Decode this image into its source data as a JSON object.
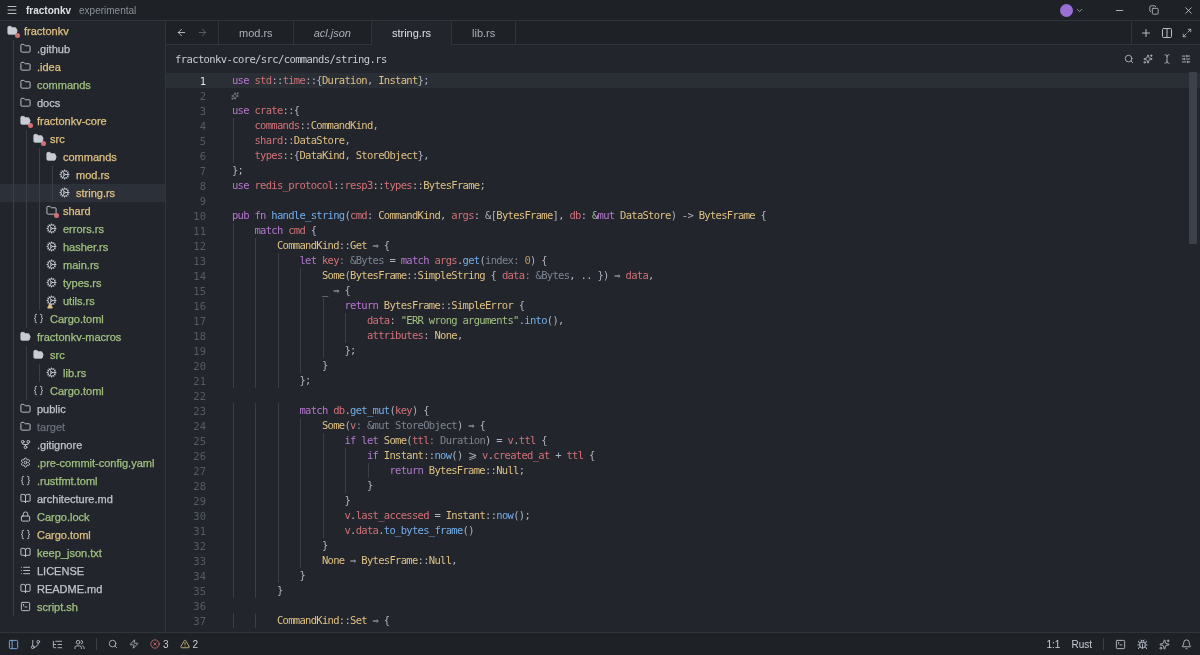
{
  "title_bar": {
    "project": "fractonkv",
    "branch": "experimental"
  },
  "sidebar": {
    "items": [
      {
        "name": "fractonkv",
        "kind": "folder",
        "color": "#dec184",
        "expanded": true,
        "selected": false,
        "has_error": true,
        "children": [
          {
            "name": ".github",
            "kind": "folder",
            "color": "#c0c5cd",
            "expanded": false,
            "selected": false
          },
          {
            "name": ".idea",
            "kind": "folder",
            "color": "#dec184",
            "expanded": false,
            "selected": false
          },
          {
            "name": "commands",
            "kind": "folder",
            "color": "#a1c181",
            "expanded": false,
            "selected": false
          },
          {
            "name": "docs",
            "kind": "folder",
            "color": "#c0c5cd",
            "expanded": false,
            "selected": false
          },
          {
            "name": "fractonkv-core",
            "kind": "folder",
            "color": "#dec184",
            "expanded": true,
            "selected": false,
            "has_error": true,
            "children": [
              {
                "name": "src",
                "kind": "folder",
                "color": "#dec184",
                "expanded": true,
                "selected": false,
                "has_error": true,
                "children": [
                  {
                    "name": "commands",
                    "kind": "folder",
                    "color": "#dec184",
                    "expanded": true,
                    "selected": false,
                    "children": [
                      {
                        "name": "mod.rs",
                        "kind": "rust",
                        "color": "#dec184",
                        "selected": false
                      },
                      {
                        "name": "string.rs",
                        "kind": "rust",
                        "color": "#dec184",
                        "selected": true
                      }
                    ]
                  },
                  {
                    "name": "shard",
                    "kind": "folder",
                    "color": "#dec184",
                    "expanded": false,
                    "selected": false,
                    "has_error": true
                  },
                  {
                    "name": "errors.rs",
                    "kind": "rust",
                    "color": "#a1c181",
                    "selected": false
                  },
                  {
                    "name": "hasher.rs",
                    "kind": "rust",
                    "color": "#a1c181",
                    "selected": false
                  },
                  {
                    "name": "main.rs",
                    "kind": "rust",
                    "color": "#a1c181",
                    "selected": false
                  },
                  {
                    "name": "types.rs",
                    "kind": "rust",
                    "color": "#a1c181",
                    "selected": false
                  },
                  {
                    "name": "utils.rs",
                    "kind": "rust",
                    "color": "#a1c181",
                    "selected": false,
                    "has_warning": true
                  }
                ]
              },
              {
                "name": "Cargo.toml",
                "kind": "toml",
                "color": "#a1c181",
                "selected": false
              }
            ]
          },
          {
            "name": "fractonkv-macros",
            "kind": "folder",
            "color": "#a1c181",
            "expanded": true,
            "selected": false,
            "children": [
              {
                "name": "src",
                "kind": "folder",
                "color": "#a1c181",
                "expanded": true,
                "selected": false,
                "children": [
                  {
                    "name": "lib.rs",
                    "kind": "rust",
                    "color": "#a1c181",
                    "selected": false
                  }
                ]
              },
              {
                "name": "Cargo.toml",
                "kind": "toml",
                "color": "#a1c181",
                "selected": false
              }
            ]
          },
          {
            "name": "public",
            "kind": "folder",
            "color": "#c0c5cd",
            "expanded": false,
            "selected": false
          },
          {
            "name": "target",
            "kind": "folder",
            "color": "#6b717c",
            "expanded": false,
            "selected": false
          },
          {
            "name": ".gitignore",
            "kind": "git",
            "color": "#c0c5cd",
            "selected": false
          },
          {
            "name": ".pre-commit-config.yaml",
            "kind": "config",
            "color": "#a1c181",
            "selected": false
          },
          {
            "name": ".rustfmt.toml",
            "kind": "toml",
            "color": "#a1c181",
            "selected": false
          },
          {
            "name": "architecture.md",
            "kind": "book",
            "color": "#c0c5cd",
            "selected": false
          },
          {
            "name": "Cargo.lock",
            "kind": "lock",
            "color": "#a1c181",
            "selected": false
          },
          {
            "name": "Cargo.toml",
            "kind": "toml",
            "color": "#dec184",
            "selected": false
          },
          {
            "name": "keep_json.txt",
            "kind": "book",
            "color": "#a1c181",
            "selected": false
          },
          {
            "name": "LICENSE",
            "kind": "text",
            "color": "#c0c5cd",
            "selected": false
          },
          {
            "name": "README.md",
            "kind": "book",
            "color": "#c0c5cd",
            "selected": false
          },
          {
            "name": "script.sh",
            "kind": "terminal",
            "color": "#a1c181",
            "selected": false
          }
        ]
      }
    ]
  },
  "tabs": [
    {
      "label": "mod.rs",
      "selected": false,
      "preview": false
    },
    {
      "label": "acl.json",
      "selected": false,
      "preview": true
    },
    {
      "label": "string.rs",
      "selected": true,
      "preview": false
    },
    {
      "label": "lib.rs",
      "selected": false,
      "preview": false
    }
  ],
  "navigation": {
    "back_disabled": false,
    "forward_disabled": true
  },
  "breadcrumb": "fractonkv-core/src/commands/string.rs",
  "editor": {
    "lines": [
      {
        "number": "1",
        "active": true,
        "tokens": [
          {
            "kind": "keyword",
            "text": "use "
          },
          {
            "kind": "variable",
            "text": "std"
          },
          {
            "kind": "plain",
            "text": "::"
          },
          {
            "kind": "variable",
            "text": "time"
          },
          {
            "kind": "plain",
            "text": "::{"
          },
          {
            "kind": "type",
            "text": "Duration"
          },
          {
            "kind": "plain",
            "text": ", "
          },
          {
            "kind": "type",
            "text": "Instant"
          },
          {
            "kind": "plain",
            "text": "};"
          }
        ]
      },
      {
        "number": "2",
        "active": false,
        "gutter_icon": true
      },
      {
        "number": "3",
        "active": false,
        "tokens": [
          {
            "kind": "keyword",
            "text": "use "
          },
          {
            "kind": "variable",
            "text": "crate"
          },
          {
            "kind": "plain",
            "text": "::{"
          }
        ]
      },
      {
        "number": "4",
        "active": false,
        "tokens": [
          {
            "kind": "variable",
            "text": "    commands"
          },
          {
            "kind": "plain",
            "text": "::"
          },
          {
            "kind": "type",
            "text": "CommandKind"
          },
          {
            "kind": "plain",
            "text": ","
          }
        ]
      },
      {
        "number": "5",
        "active": false,
        "tokens": [
          {
            "kind": "variable",
            "text": "    shard"
          },
          {
            "kind": "plain",
            "text": "::"
          },
          {
            "kind": "type",
            "text": "DataStore"
          },
          {
            "kind": "plain",
            "text": ","
          }
        ]
      },
      {
        "number": "6",
        "active": false,
        "tokens": [
          {
            "kind": "variable",
            "text": "    types"
          },
          {
            "kind": "plain",
            "text": "::{"
          },
          {
            "kind": "type",
            "text": "DataKind"
          },
          {
            "kind": "plain",
            "text": ", "
          },
          {
            "kind": "type",
            "text": "StoreObject"
          },
          {
            "kind": "plain",
            "text": "},"
          }
        ]
      },
      {
        "number": "7",
        "active": false,
        "tokens": [
          {
            "kind": "plain",
            "text": "};"
          }
        ]
      },
      {
        "number": "8",
        "active": false,
        "tokens": [
          {
            "kind": "keyword",
            "text": "use "
          },
          {
            "kind": "variable",
            "text": "redis_protocol"
          },
          {
            "kind": "plain",
            "text": "::"
          },
          {
            "kind": "variable",
            "text": "resp3"
          },
          {
            "kind": "plain",
            "text": "::"
          },
          {
            "kind": "variable",
            "text": "types"
          },
          {
            "kind": "plain",
            "text": "::"
          },
          {
            "kind": "type",
            "text": "BytesFrame"
          },
          {
            "kind": "plain",
            "text": ";"
          }
        ]
      },
      {
        "number": "9",
        "active": false
      },
      {
        "number": "10",
        "active": false,
        "tokens": [
          {
            "kind": "keyword",
            "text": "pub fn "
          },
          {
            "kind": "function",
            "text": "handle_string"
          },
          {
            "kind": "plain",
            "text": "("
          },
          {
            "kind": "variable",
            "text": "cmd"
          },
          {
            "kind": "plain",
            "text": ": "
          },
          {
            "kind": "type",
            "text": "CommandKind"
          },
          {
            "kind": "plain",
            "text": ", "
          },
          {
            "kind": "variable",
            "text": "args"
          },
          {
            "kind": "plain",
            "text": ": &["
          },
          {
            "kind": "type",
            "text": "BytesFrame"
          },
          {
            "kind": "plain",
            "text": "], "
          },
          {
            "kind": "variable",
            "text": "db"
          },
          {
            "kind": "plain",
            "text": ": &"
          },
          {
            "kind": "keyword",
            "text": "mut "
          },
          {
            "kind": "type",
            "text": "DataStore"
          },
          {
            "kind": "plain",
            "text": ") -> "
          },
          {
            "kind": "type",
            "text": "BytesFrame"
          },
          {
            "kind": "plain",
            "text": " {"
          }
        ]
      },
      {
        "number": "11",
        "active": false,
        "tokens": [
          {
            "kind": "keyword",
            "text": "    match "
          },
          {
            "kind": "variable",
            "text": "cmd"
          },
          {
            "kind": "plain",
            "text": " {"
          }
        ]
      },
      {
        "number": "12",
        "active": false,
        "tokens": [
          {
            "kind": "type",
            "text": "        CommandKind"
          },
          {
            "kind": "plain",
            "text": "::"
          },
          {
            "kind": "type",
            "text": "Get"
          },
          {
            "kind": "plain",
            "text": " ⇒ {"
          }
        ]
      },
      {
        "number": "13",
        "active": false,
        "tokens": [
          {
            "kind": "keyword",
            "text": "            let "
          },
          {
            "kind": "variable",
            "text": "key"
          },
          {
            "kind": "hint",
            "text": ": &Bytes"
          },
          {
            "kind": "plain",
            "text": " = "
          },
          {
            "kind": "keyword",
            "text": "match "
          },
          {
            "kind": "variable",
            "text": "args"
          },
          {
            "kind": "plain",
            "text": "."
          },
          {
            "kind": "function",
            "text": "get"
          },
          {
            "kind": "plain",
            "text": "("
          },
          {
            "kind": "hint",
            "text": "index: "
          },
          {
            "kind": "number",
            "text": "0"
          },
          {
            "kind": "plain",
            "text": ") {"
          }
        ]
      },
      {
        "number": "14",
        "active": false,
        "tokens": [
          {
            "kind": "type",
            "text": "                Some"
          },
          {
            "kind": "plain",
            "text": "("
          },
          {
            "kind": "type",
            "text": "BytesFrame"
          },
          {
            "kind": "plain",
            "text": "::"
          },
          {
            "kind": "type",
            "text": "SimpleString"
          },
          {
            "kind": "plain",
            "text": " { "
          },
          {
            "kind": "variable",
            "text": "data"
          },
          {
            "kind": "hint",
            "text": ": &Bytes"
          },
          {
            "kind": "plain",
            "text": ", .. }) ⇒ "
          },
          {
            "kind": "variable",
            "text": "data"
          },
          {
            "kind": "plain",
            "text": ","
          }
        ]
      },
      {
        "number": "15",
        "active": false,
        "tokens": [
          {
            "kind": "plain",
            "text": "                _ ⇒ {"
          }
        ]
      },
      {
        "number": "16",
        "active": false,
        "tokens": [
          {
            "kind": "keyword",
            "text": "                    return "
          },
          {
            "kind": "type",
            "text": "BytesFrame"
          },
          {
            "kind": "plain",
            "text": "::"
          },
          {
            "kind": "type",
            "text": "SimpleError"
          },
          {
            "kind": "plain",
            "text": " {"
          }
        ]
      },
      {
        "number": "17",
        "active": false,
        "tokens": [
          {
            "kind": "variable",
            "text": "                        data"
          },
          {
            "kind": "plain",
            "text": ": "
          },
          {
            "kind": "string",
            "text": "\"ERR wrong arguments\""
          },
          {
            "kind": "plain",
            "text": "."
          },
          {
            "kind": "function",
            "text": "into"
          },
          {
            "kind": "plain",
            "text": "(),"
          }
        ]
      },
      {
        "number": "18",
        "active": false,
        "tokens": [
          {
            "kind": "variable",
            "text": "                        attributes"
          },
          {
            "kind": "plain",
            "text": ": "
          },
          {
            "kind": "type",
            "text": "None"
          },
          {
            "kind": "plain",
            "text": ","
          }
        ]
      },
      {
        "number": "19",
        "active": false,
        "tokens": [
          {
            "kind": "plain",
            "text": "                    };"
          }
        ]
      },
      {
        "number": "20",
        "active": false,
        "tokens": [
          {
            "kind": "plain",
            "text": "                }"
          }
        ]
      },
      {
        "number": "21",
        "active": false,
        "tokens": [
          {
            "kind": "plain",
            "text": "            };"
          }
        ]
      },
      {
        "number": "22",
        "active": false
      },
      {
        "number": "23",
        "active": false,
        "tokens": [
          {
            "kind": "keyword",
            "text": "            match "
          },
          {
            "kind": "variable",
            "text": "db"
          },
          {
            "kind": "plain",
            "text": "."
          },
          {
            "kind": "function",
            "text": "get_mut"
          },
          {
            "kind": "plain",
            "text": "("
          },
          {
            "kind": "variable",
            "text": "key"
          },
          {
            "kind": "plain",
            "text": ") {"
          }
        ]
      },
      {
        "number": "24",
        "active": false,
        "tokens": [
          {
            "kind": "type",
            "text": "                Some"
          },
          {
            "kind": "plain",
            "text": "("
          },
          {
            "kind": "variable",
            "text": "v"
          },
          {
            "kind": "hint",
            "text": ": &mut StoreObject"
          },
          {
            "kind": "plain",
            "text": ") ⇒ {"
          }
        ]
      },
      {
        "number": "25",
        "active": false,
        "tokens": [
          {
            "kind": "keyword",
            "text": "                    if let "
          },
          {
            "kind": "type",
            "text": "Some"
          },
          {
            "kind": "plain",
            "text": "("
          },
          {
            "kind": "variable",
            "text": "ttl"
          },
          {
            "kind": "hint",
            "text": ": Duration"
          },
          {
            "kind": "plain",
            "text": ") = "
          },
          {
            "kind": "variable",
            "text": "v"
          },
          {
            "kind": "plain",
            "text": "."
          },
          {
            "kind": "variable",
            "text": "ttl"
          },
          {
            "kind": "plain",
            "text": " {"
          }
        ]
      },
      {
        "number": "26",
        "active": false,
        "tokens": [
          {
            "kind": "keyword",
            "text": "                        if "
          },
          {
            "kind": "type",
            "text": "Instant"
          },
          {
            "kind": "plain",
            "text": "::"
          },
          {
            "kind": "function",
            "text": "now"
          },
          {
            "kind": "plain",
            "text": "() ⩾ "
          },
          {
            "kind": "variable",
            "text": "v"
          },
          {
            "kind": "plain",
            "text": "."
          },
          {
            "kind": "variable",
            "text": "created_at"
          },
          {
            "kind": "plain",
            "text": " + "
          },
          {
            "kind": "variable",
            "text": "ttl"
          },
          {
            "kind": "plain",
            "text": " {"
          }
        ]
      },
      {
        "number": "27",
        "active": false,
        "tokens": [
          {
            "kind": "keyword",
            "text": "                            return "
          },
          {
            "kind": "type",
            "text": "BytesFrame"
          },
          {
            "kind": "plain",
            "text": "::"
          },
          {
            "kind": "type",
            "text": "Null"
          },
          {
            "kind": "plain",
            "text": ";"
          }
        ]
      },
      {
        "number": "28",
        "active": false,
        "tokens": [
          {
            "kind": "plain",
            "text": "                        }"
          }
        ]
      },
      {
        "number": "29",
        "active": false,
        "tokens": [
          {
            "kind": "plain",
            "text": "                    }"
          }
        ]
      },
      {
        "number": "30",
        "active": false,
        "tokens": [
          {
            "kind": "variable",
            "text": "                    v"
          },
          {
            "kind": "plain",
            "text": "."
          },
          {
            "kind": "variable",
            "text": "last_accessed"
          },
          {
            "kind": "plain",
            "text": " = "
          },
          {
            "kind": "type",
            "text": "Instant"
          },
          {
            "kind": "plain",
            "text": "::"
          },
          {
            "kind": "function",
            "text": "now"
          },
          {
            "kind": "plain",
            "text": "();"
          }
        ]
      },
      {
        "number": "31",
        "active": false,
        "tokens": [
          {
            "kind": "variable",
            "text": "                    v"
          },
          {
            "kind": "plain",
            "text": "."
          },
          {
            "kind": "variable",
            "text": "data"
          },
          {
            "kind": "plain",
            "text": "."
          },
          {
            "kind": "function",
            "text": "to_bytes_frame"
          },
          {
            "kind": "plain",
            "text": "()"
          }
        ]
      },
      {
        "number": "32",
        "active": false,
        "tokens": [
          {
            "kind": "plain",
            "text": "                }"
          }
        ]
      },
      {
        "number": "33",
        "active": false,
        "tokens": [
          {
            "kind": "type",
            "text": "                None"
          },
          {
            "kind": "plain",
            "text": " ⇒ "
          },
          {
            "kind": "type",
            "text": "BytesFrame"
          },
          {
            "kind": "plain",
            "text": "::"
          },
          {
            "kind": "type",
            "text": "Null"
          },
          {
            "kind": "plain",
            "text": ","
          }
        ]
      },
      {
        "number": "34",
        "active": false,
        "tokens": [
          {
            "kind": "plain",
            "text": "            }"
          }
        ]
      },
      {
        "number": "35",
        "active": false,
        "tokens": [
          {
            "kind": "plain",
            "text": "        }"
          }
        ]
      },
      {
        "number": "36",
        "active": false
      },
      {
        "number": "37",
        "active": false,
        "tokens": [
          {
            "kind": "type",
            "text": "        CommandKind"
          },
          {
            "kind": "plain",
            "text": "::"
          },
          {
            "kind": "type",
            "text": "Set"
          },
          {
            "kind": "plain",
            "text": " ⇒ {"
          }
        ]
      }
    ]
  },
  "status_bar": {
    "errors": "3",
    "warnings": "2",
    "cursor": "1:1",
    "language": "Rust"
  }
}
